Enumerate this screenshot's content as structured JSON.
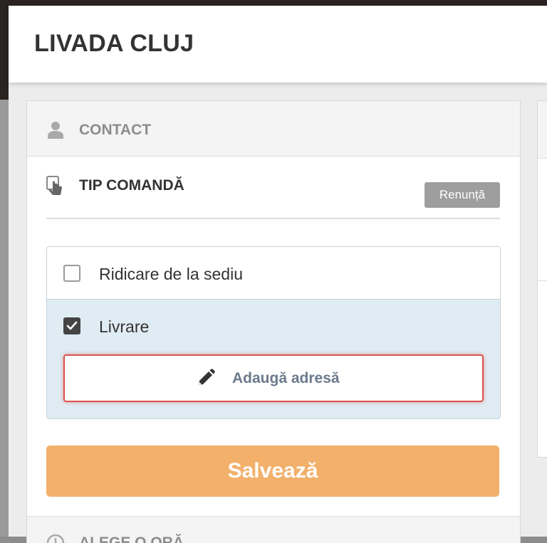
{
  "modal": {
    "title": "LIVADA CLUJ"
  },
  "sections": {
    "contact": {
      "label": "CONTACT",
      "icon": "user-icon"
    },
    "order_type": {
      "label": "TIP COMANDĂ",
      "icon": "tap-hand-icon",
      "cancel_label": "Renunță",
      "options": [
        {
          "label": "Ridicare de la sediu",
          "checked": false
        },
        {
          "label": "Livrare",
          "checked": true
        }
      ],
      "add_address_label": "Adaugă adresă",
      "add_address_icon": "pencil-icon"
    },
    "save_label": "Salvează",
    "time": {
      "label": "ALEGE O ORĂ",
      "icon": "clock-icon"
    }
  },
  "colors": {
    "save_button": "#f3b06b",
    "selected_option_bg": "#e0ecf3",
    "error_border": "#d9534f",
    "cancel_button": "#9e9e9e"
  }
}
